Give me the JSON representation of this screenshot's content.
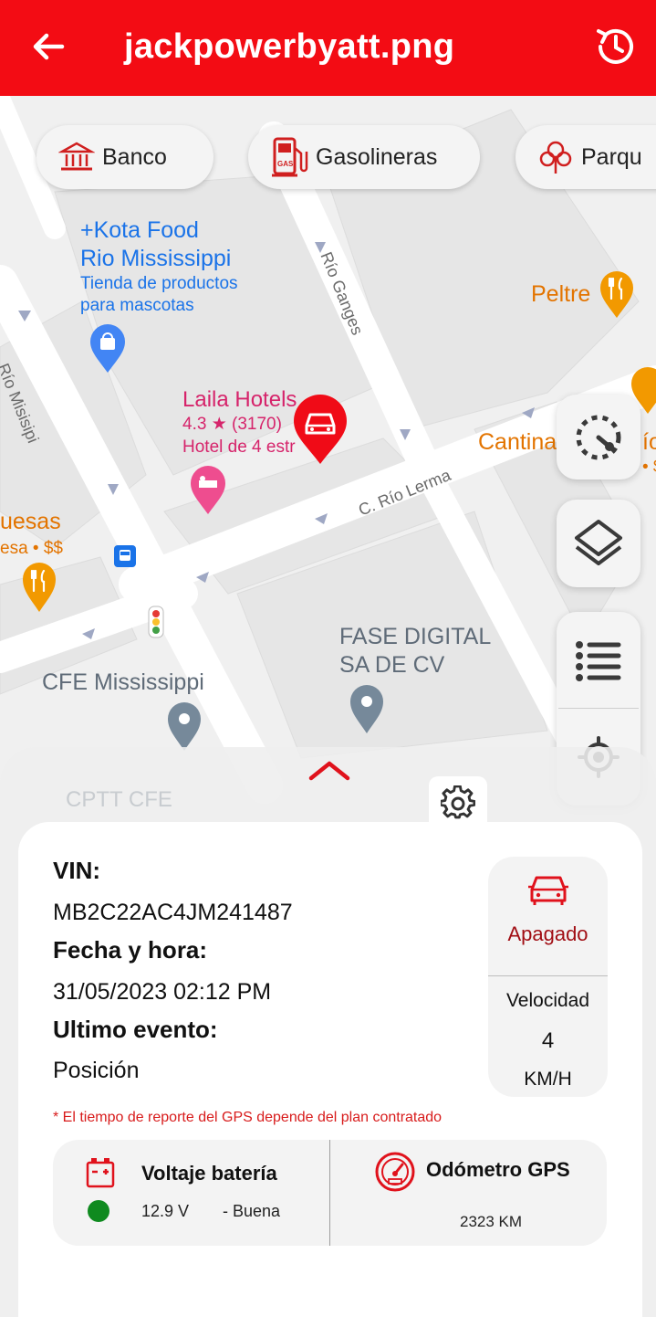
{
  "header": {
    "title": "jackpowerbyatt.png",
    "back_icon": "arrow-left-icon",
    "history_icon": "history-clock-icon"
  },
  "chips": [
    {
      "label": "Banco",
      "icon": "bank-icon"
    },
    {
      "label": "Gasolineras",
      "icon": "gas-station-icon"
    },
    {
      "label": "Parqu",
      "icon": "park-icon"
    }
  ],
  "map": {
    "places": {
      "kota_line1": "+Kota Food",
      "kota_line2": "Rio Mississippi",
      "kota_sub1": "Tienda de productos",
      "kota_sub2": "para mascotas",
      "peltre": "Peltre",
      "laila": "Laila Hotels",
      "laila_rating": "4.3 ★ (3170)",
      "laila_sub": "Hotel de 4 estr",
      "cantina": "Cantina",
      "cantina_tail": "ío",
      "cantina_sub": "• $",
      "quesas": "uesas",
      "quesas_sub": "esa • $$",
      "cfe": "CFE Mississippi",
      "fase1": "FASE DIGITAL",
      "fase2": "SA DE CV",
      "cptt": "CPTT CFE"
    },
    "streets": {
      "rio_misisipi": "Río Misisipi",
      "rio_ganges": "Río Ganges",
      "rio_lerma": "C. Río Lerma"
    }
  },
  "side_buttons": [
    "speed-dial-icon",
    "layers-icon",
    "list-icon",
    "locate-target-icon"
  ],
  "vehicle": {
    "vin_label": "VIN:",
    "vin": "MB2C22AC4JM241487",
    "date_label": "Fecha y hora:",
    "date": "31/05/2023 02:12 PM",
    "event_label": "Ultimo evento:",
    "event": "Posición",
    "status": "Apagado",
    "speed_label": "Velocidad",
    "speed": "4",
    "speed_unit": "KM/H",
    "note": "* El tiempo de reporte del GPS depende del plan contratado"
  },
  "metrics": {
    "battery_title": "Voltaje batería",
    "battery_value": "12.9 V",
    "battery_status": "- Buena",
    "battery_status_color": "#0f8a1f",
    "odometer_title": "Odómetro GPS",
    "odometer_value": "2323 KM"
  },
  "colors": {
    "accent": "#f30c14"
  }
}
